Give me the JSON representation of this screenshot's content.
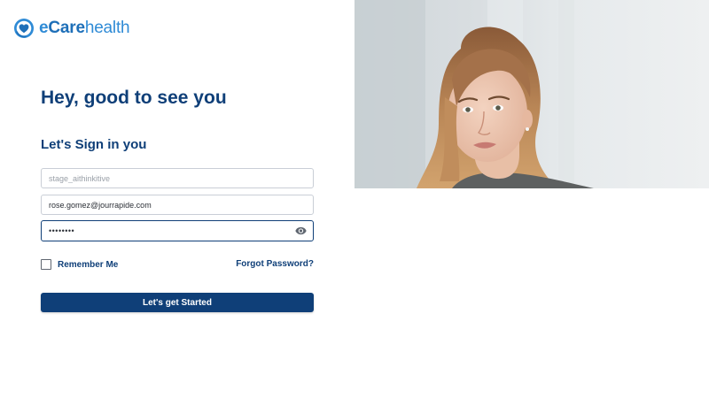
{
  "brand": {
    "name_prefix": "e",
    "name_care": "Care",
    "name_health": "health",
    "logo_icon": "heart-shield-icon",
    "colors": {
      "primary": "#0f3f78",
      "logo_blue": "#2f8bd6"
    }
  },
  "login": {
    "heading": "Hey, good to see you",
    "subheading": "Let's Sign in you",
    "username_placeholder": "stage_aithinkitive",
    "email_value": "rose.gomez@jourrapide.com",
    "password_value": "sample12",
    "password_toggle_icon": "eye-icon",
    "remember_label": "Remember Me",
    "remember_checked": false,
    "forgot_label": "Forgot Password?",
    "submit_label": "Let's get Started"
  },
  "hero": {
    "image": "woman-portrait-photo"
  }
}
